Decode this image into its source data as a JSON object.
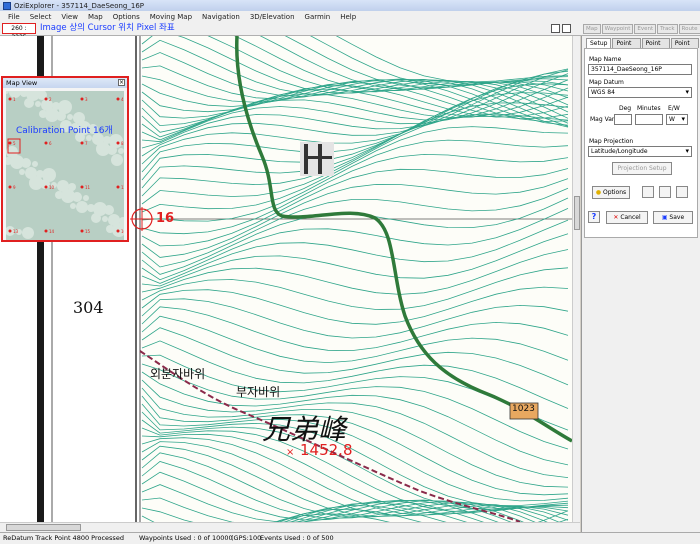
{
  "window": {
    "title": "OziExplorer - 357114_DaeSeong_16P"
  },
  "menu": [
    "File",
    "Select",
    "View",
    "Map",
    "Options",
    "Moving Map",
    "Navigation",
    "3D/Elevation",
    "Garmin",
    "Help"
  ],
  "toolbar": {
    "cursor_coords": "260 : 3335",
    "annotation": "Image 상의 Cursor 위치 Pixel 좌표",
    "right_tabs": [
      "Map",
      "Waypoint",
      "Event",
      "Track",
      "Route"
    ]
  },
  "map_view": {
    "title": "Map View",
    "annotation": "Calibration Point 16개",
    "point_labels": [
      "1",
      "2",
      "3",
      "4",
      "5",
      "6",
      "7",
      "8",
      "9",
      "10",
      "11",
      "12",
      "13",
      "14",
      "15",
      "16"
    ]
  },
  "map": {
    "marker_label": "16",
    "grid_number": "304",
    "place_1": "외분자바위",
    "place_2": "부자바위",
    "peak_name": "兄弟峰",
    "elevation": "1452.8",
    "road_number": "1023"
  },
  "side_panel": {
    "tabs": [
      "Setup",
      "Point 1",
      "Point 2",
      "Point 3"
    ],
    "map_name_label": "Map Name",
    "map_name_value": "357114_DaeSeong_16P",
    "map_datum_label": "Map Datum",
    "map_datum_value": "WGS 84",
    "deg_label": "Deg",
    "minutes_label": "Minutes",
    "ew_label": "E/W",
    "mag_var_label": "Mag Var",
    "ew_value": "W",
    "projection_label": "Map Projection",
    "projection_value": "Latitude/Longitude",
    "projection_setup_label": "Projection Setup",
    "options_label": "Options",
    "cancel_label": "Cancel",
    "save_label": "Save",
    "help_label": "?"
  },
  "status": {
    "left": "ReDatum Track Point 4800 Processed",
    "waypoints": "Waypoints Used : 0 of 10000",
    "gps": "(GPS:100",
    "events": "Events Used : 0 of 500"
  },
  "colors": {
    "annotation_blue": "#1a3cff",
    "highlight_red": "#e02020",
    "contour_green": "#2fa58a",
    "road_green": "#2f7a3a",
    "road_badge": "#e8a860"
  }
}
